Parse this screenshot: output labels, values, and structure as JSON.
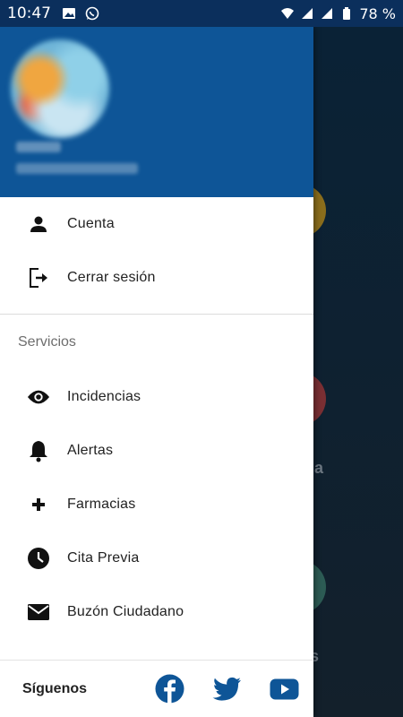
{
  "status_bar": {
    "time": "10:47",
    "battery": "78 %",
    "left_icons": [
      "image-icon",
      "whatsapp-icon"
    ],
    "right_icons": [
      "wifi-icon",
      "signal-icon",
      "signal-icon",
      "battery-icon"
    ]
  },
  "drawer": {
    "header_color": "#0e5597",
    "account": [
      {
        "label": "Cuenta",
        "icon": "person-icon"
      },
      {
        "label": "Cerrar sesión",
        "icon": "logout-icon"
      }
    ],
    "services_title": "Servicios",
    "services": [
      {
        "label": "Incidencias",
        "icon": "eye-icon"
      },
      {
        "label": "Alertas",
        "icon": "bell-icon"
      },
      {
        "label": "Farmacias",
        "icon": "plus-icon"
      },
      {
        "label": "Cita Previa",
        "icon": "clock-icon"
      },
      {
        "label": "Buzón Ciudadano",
        "icon": "mail-icon"
      }
    ],
    "footer": {
      "label": "Síguenos",
      "social": [
        "facebook-icon",
        "twitter-icon",
        "youtube-icon"
      ],
      "social_color": "#0e5597"
    }
  },
  "background": {
    "partial_text_1": "ia",
    "partial_text_2": "s"
  }
}
